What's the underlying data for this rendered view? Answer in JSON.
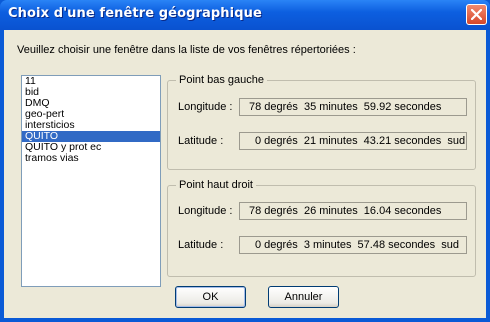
{
  "window": {
    "title": "Choix d'une fenêtre géographique"
  },
  "instruction": "Veuillez choisir une fenêtre dans la liste de vos fenêtres répertoriées :",
  "list": {
    "items": [
      "11",
      "bid",
      "DMQ",
      "geo-pert",
      "intersticios",
      "QUITO",
      "QUITO y prot ec",
      "tramos vias"
    ],
    "selected": "QUITO"
  },
  "bottom_left": {
    "legend": "Point bas gauche",
    "longitude_label": "Longitude :",
    "latitude_label": "Latitude :",
    "longitude": {
      "deg": "78",
      "deg_unit": "degrés",
      "min": "35",
      "min_unit": "minutes",
      "sec": "59.92",
      "sec_unit": "secondes",
      "hemi": ""
    },
    "latitude": {
      "deg": "0",
      "deg_unit": "degrés",
      "min": "21",
      "min_unit": "minutes",
      "sec": "43.21",
      "sec_unit": "secondes",
      "hemi": "sud"
    }
  },
  "top_right": {
    "legend": "Point haut droit",
    "longitude_label": "Longitude :",
    "latitude_label": "Latitude :",
    "longitude": {
      "deg": "78",
      "deg_unit": "degrés",
      "min": "26",
      "min_unit": "minutes",
      "sec": "16.04",
      "sec_unit": "secondes",
      "hemi": ""
    },
    "latitude": {
      "deg": "0",
      "deg_unit": "degrés",
      "min": "3",
      "min_unit": "minutes",
      "sec": "57.48",
      "sec_unit": "secondes",
      "hemi": "sud"
    }
  },
  "buttons": {
    "ok": "OK",
    "cancel": "Annuler"
  },
  "colors": {
    "titlebar": "#0a52d0",
    "selection": "#316ac5",
    "face": "#ece9d8",
    "close": "#d6472b"
  }
}
